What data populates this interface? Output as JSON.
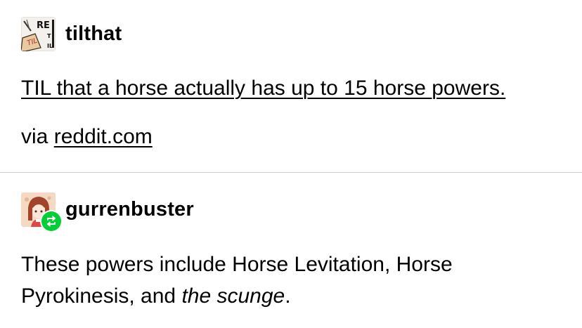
{
  "posts": [
    {
      "username": "tilthat",
      "avatar_icon": "til-reddit-avatar-icon",
      "title": "TIL that a horse actually has up to 15 horse powers.",
      "via_prefix": "via",
      "via_link": "reddit.com"
    },
    {
      "username": "gurrenbuster",
      "avatar_icon": "anime-character-avatar-icon",
      "badge_icon": "reblog-icon",
      "reply_start": "These powers include Horse Levitation, Horse Pyrokinesis, and ",
      "reply_emphasis": "the scunge",
      "reply_end": "."
    }
  ],
  "colors": {
    "text": "#000000",
    "divider": "#cfcfcf",
    "reblog_green": "#00cf35",
    "background": "#ffffff"
  }
}
